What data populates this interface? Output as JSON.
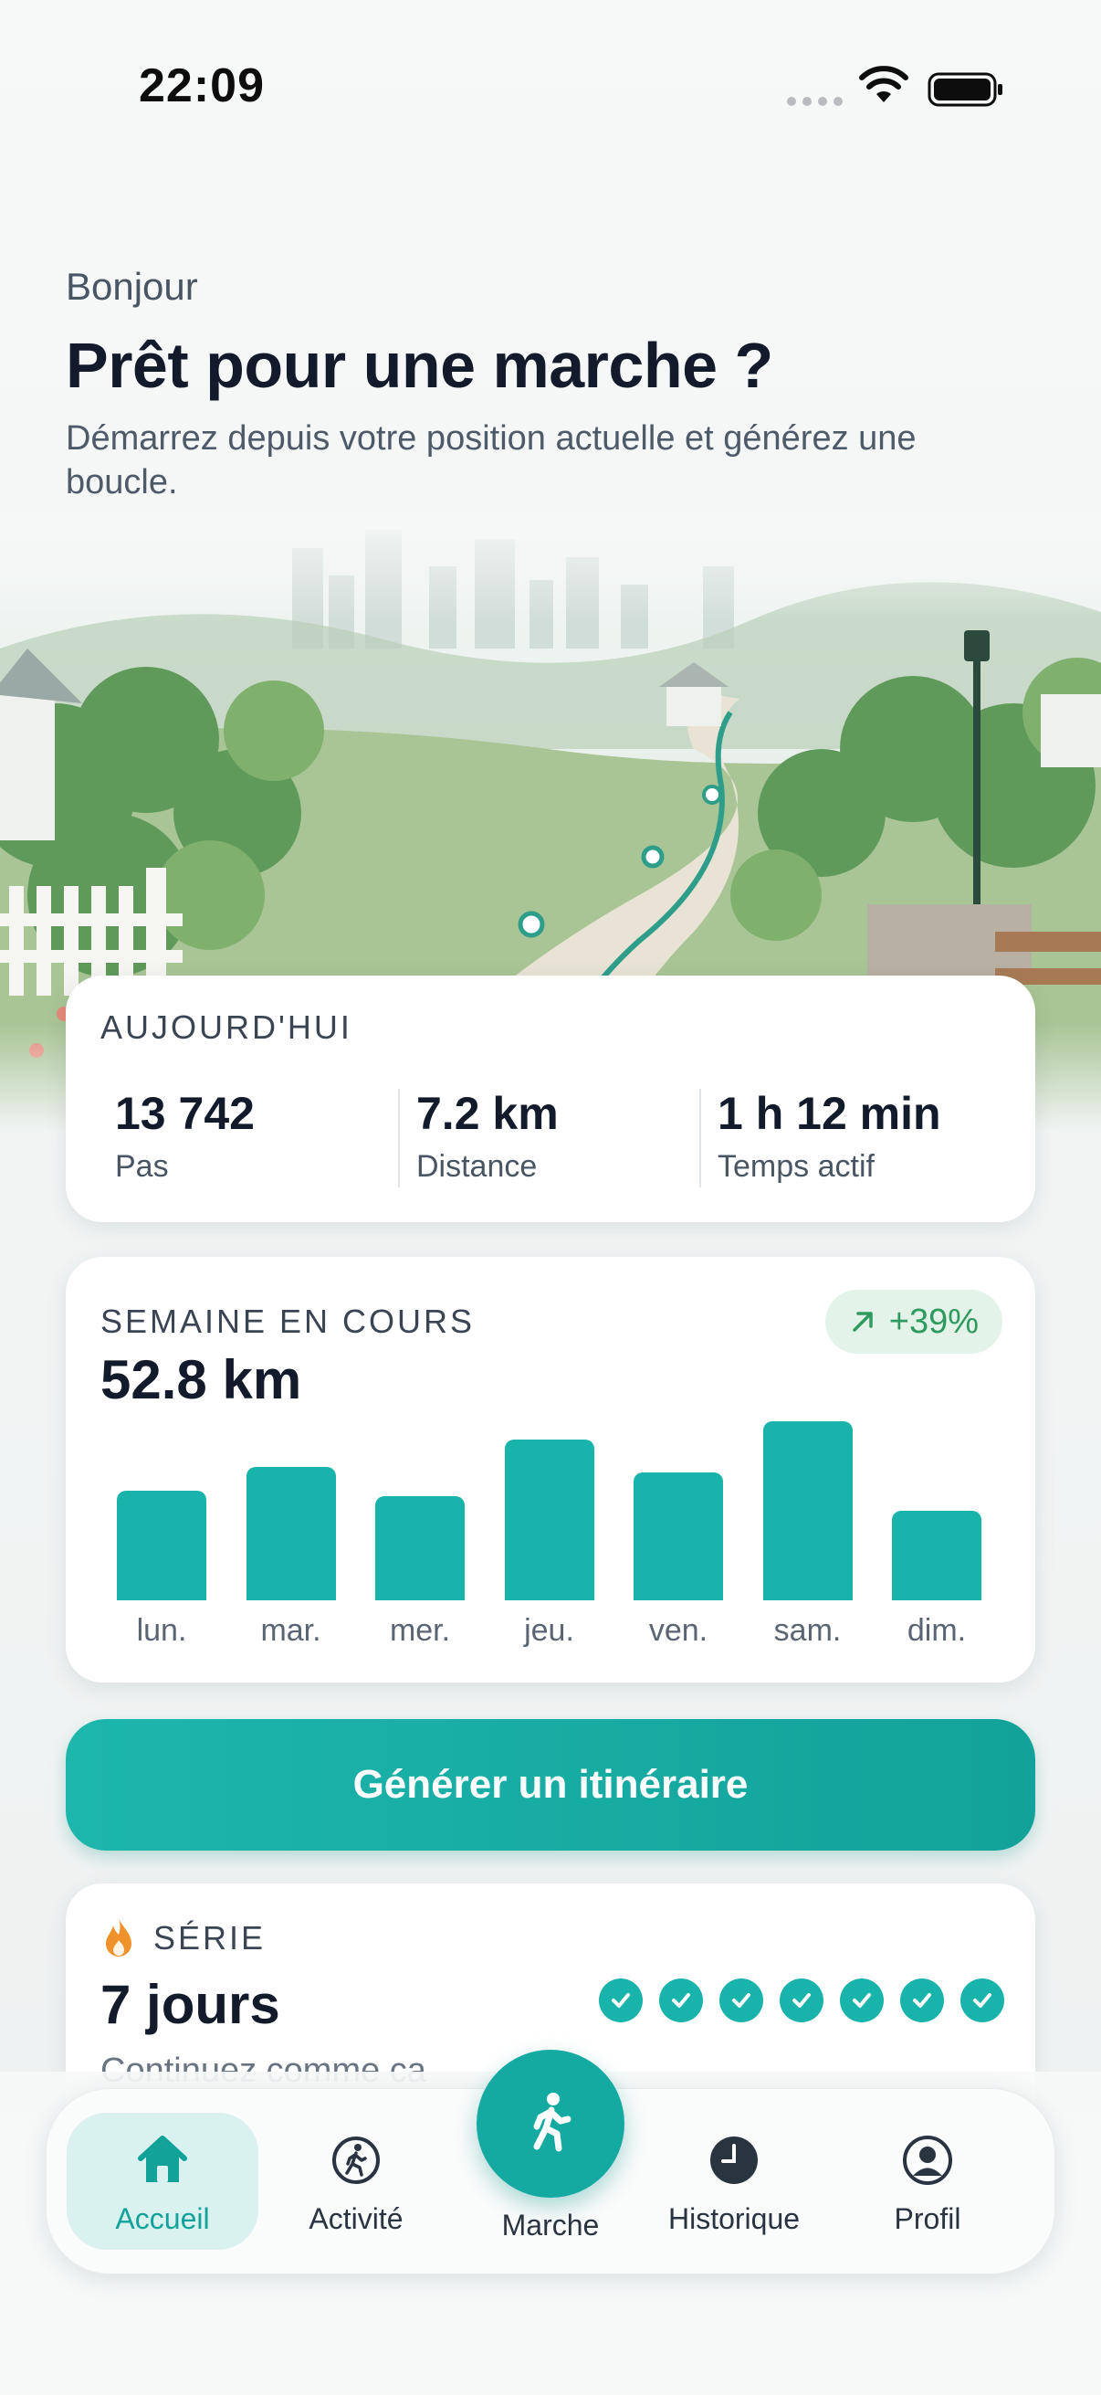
{
  "status_bar": {
    "time": "22:09",
    "icons": [
      "signal-dots-icon",
      "wifi-icon",
      "battery-icon"
    ]
  },
  "header": {
    "greeting": "Bonjour",
    "title": "Prêt pour une marche ?",
    "subtitle": "Démarrez depuis votre position actuelle et générez une boucle."
  },
  "today": {
    "label": "AUJOURD'HUI",
    "stats": [
      {
        "value": "13 742",
        "label": "Pas"
      },
      {
        "value": "7.2 km",
        "label": "Distance"
      },
      {
        "value": "1 h 12 min",
        "label": "Temps actif"
      }
    ]
  },
  "week": {
    "label": "SEMAINE EN COURS",
    "total": "52.8 km",
    "trend": "+39%",
    "trend_icon": "arrow-up-right-icon"
  },
  "chart_data": {
    "type": "bar",
    "categories": [
      "lun.",
      "mar.",
      "mer.",
      "jeu.",
      "ven.",
      "sam.",
      "dim."
    ],
    "values": [
      6.0,
      7.3,
      5.7,
      8.8,
      7.0,
      9.8,
      4.9
    ],
    "ylim": [
      0,
      10
    ],
    "grid": false,
    "color": "#18b3aa"
  },
  "cta": {
    "label": "Générer un itinéraire"
  },
  "streak": {
    "label": "SÉRIE",
    "days": "7 jours",
    "hint": "Continuez comme ca",
    "completed_days": 7,
    "icon": "flame-icon"
  },
  "tabs": [
    {
      "label": "Accueil",
      "icon": "home-icon",
      "active": true
    },
    {
      "label": "Activité",
      "icon": "walker-circle-icon",
      "active": false
    },
    {
      "label": "Marche",
      "icon": "walking-person-icon",
      "active": false
    },
    {
      "label": "Historique",
      "icon": "clock-icon",
      "active": false
    },
    {
      "label": "Profil",
      "icon": "user-circle-icon",
      "active": false
    }
  ],
  "colors": {
    "accent": "#18b3aa",
    "accent_dark": "#12a29a",
    "trend_green": "#2f9a5e",
    "trend_bg": "#e3f3ea",
    "streak_orange": "#f0922b"
  }
}
